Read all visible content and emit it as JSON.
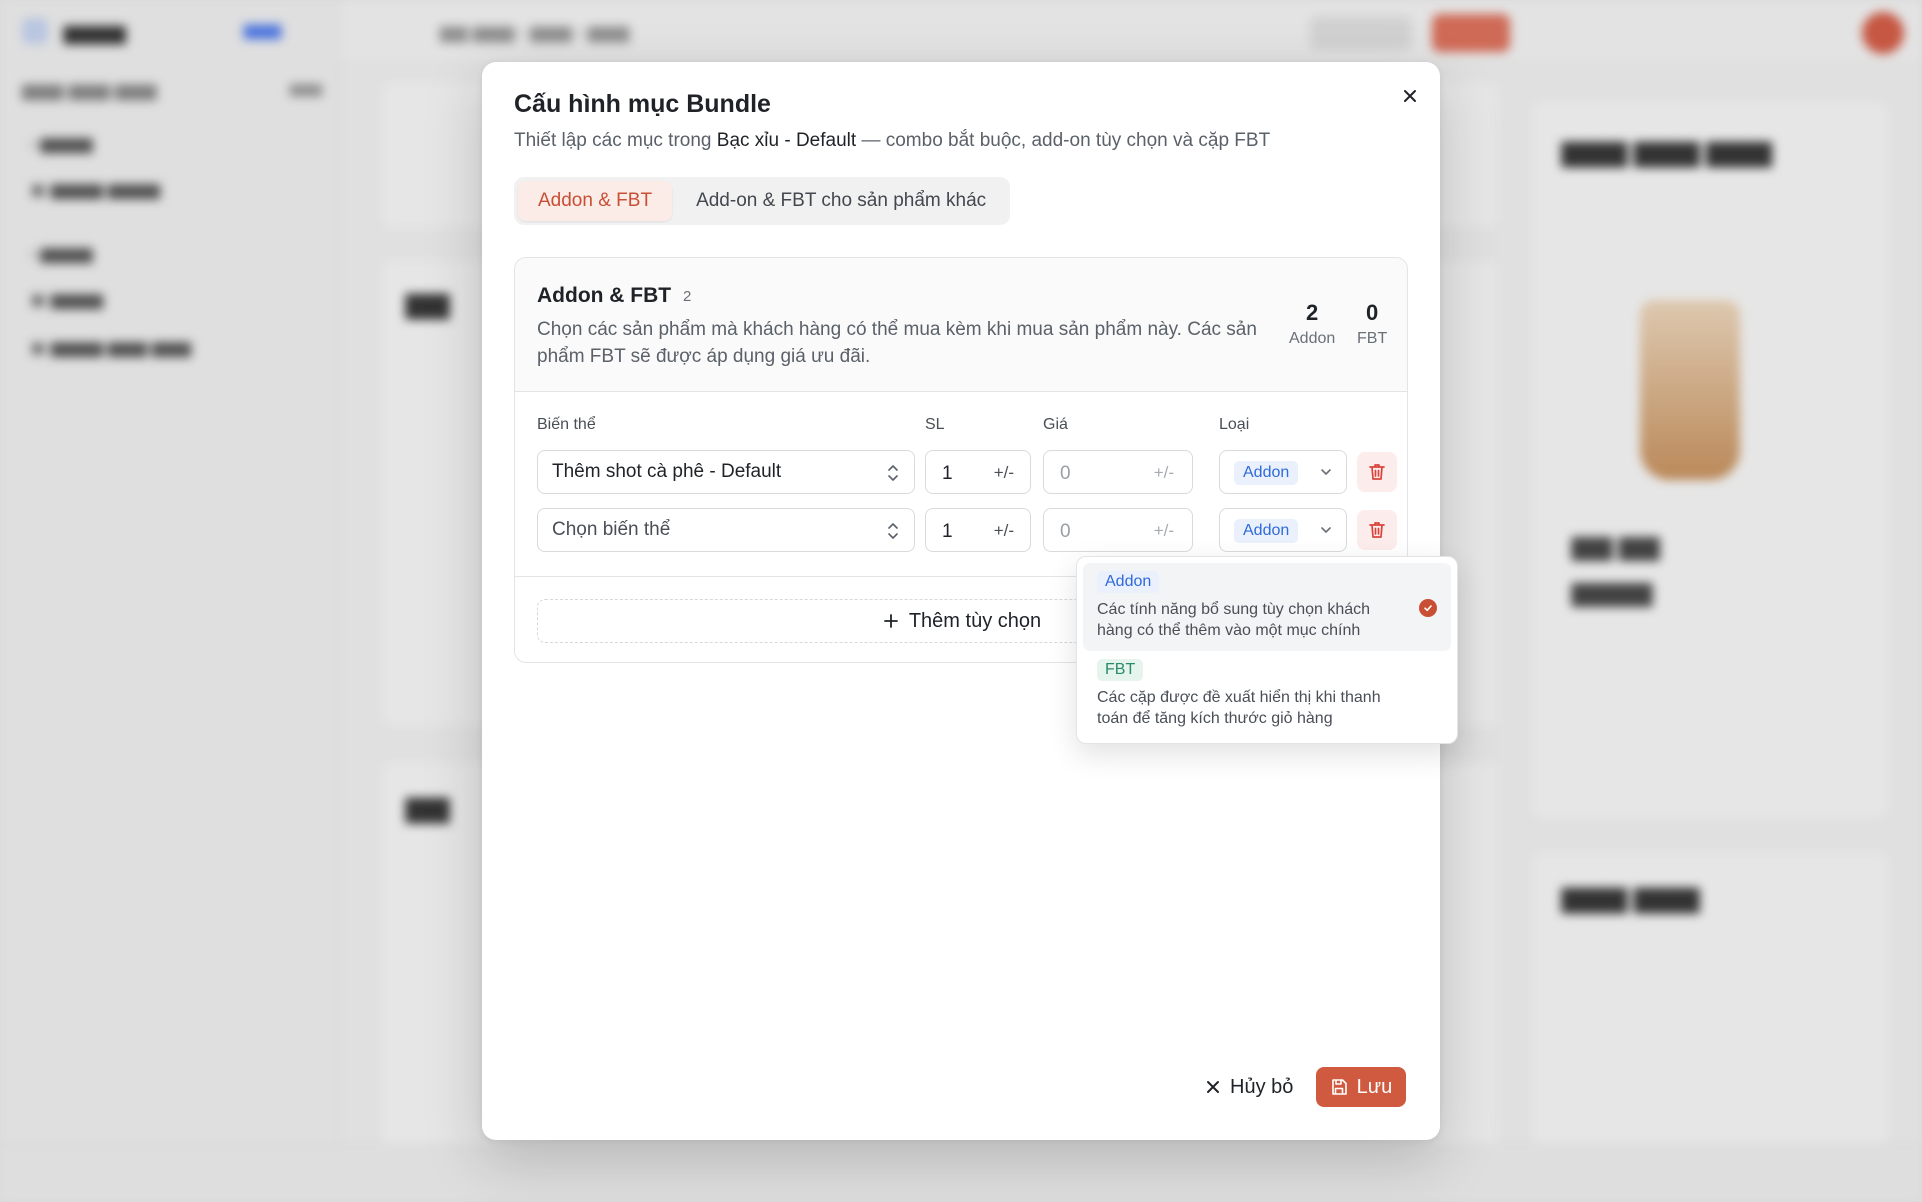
{
  "modal": {
    "title": "Cấu hình mục Bundle",
    "subtitle_prefix": "Thiết lập các mục trong ",
    "subtitle_product": "Bạc xỉu - Default",
    "subtitle_suffix": " — combo bắt buộc, add-on tùy chọn và cặp FBT",
    "tabs": [
      {
        "label": "Addon & FBT",
        "active": true
      },
      {
        "label": "Add-on & FBT cho sản phẩm khác",
        "active": false
      }
    ],
    "panel": {
      "title": "Addon & FBT",
      "count": "2",
      "description": "Chọn các sản phẩm mà khách hàng có thể mua kèm khi mua sản phẩm này. Các sản phẩm FBT sẽ được áp dụng giá ưu đãi.",
      "stats": [
        {
          "value": "2",
          "label": "Addon"
        },
        {
          "value": "0",
          "label": "FBT"
        }
      ],
      "columns": {
        "variant": "Biến thể",
        "qty": "SL",
        "price": "Giá",
        "type": "Loại"
      },
      "rows": [
        {
          "variant": "Thêm shot cà phê - Default",
          "is_placeholder": false,
          "qty": "1",
          "qty_suffix": "+/-",
          "price": "0",
          "price_suffix": "+/-",
          "type": "Addon"
        },
        {
          "variant": "Chọn biến thể",
          "is_placeholder": true,
          "qty": "1",
          "qty_suffix": "+/-",
          "price": "0",
          "price_suffix": "+/-",
          "type": "Addon"
        }
      ],
      "add_option_label": "Thêm tùy chọn"
    },
    "cancel_label": "Hủy bỏ",
    "save_label": "Lưu"
  },
  "type_dropdown": {
    "options": [
      {
        "tag": "Addon",
        "description": "Các tính năng bổ sung tùy chọn khách hàng có thể thêm vào một mục chính",
        "selected": true
      },
      {
        "tag": "FBT",
        "description": "Các cặp được đề xuất hiển thị khi thanh toán để tăng kích thước giỏ hàng",
        "selected": false
      }
    ]
  },
  "colors": {
    "accent": "#cf5a3f",
    "addon_badge": "#2f6ad9",
    "fbt_badge": "#2a8a6a",
    "danger": "#d9443a"
  },
  "icons": [
    "close-icon",
    "chevron-updown-icon",
    "chevron-down-icon",
    "trash-icon",
    "plus-icon",
    "x-icon",
    "save-icon",
    "check-icon"
  ]
}
